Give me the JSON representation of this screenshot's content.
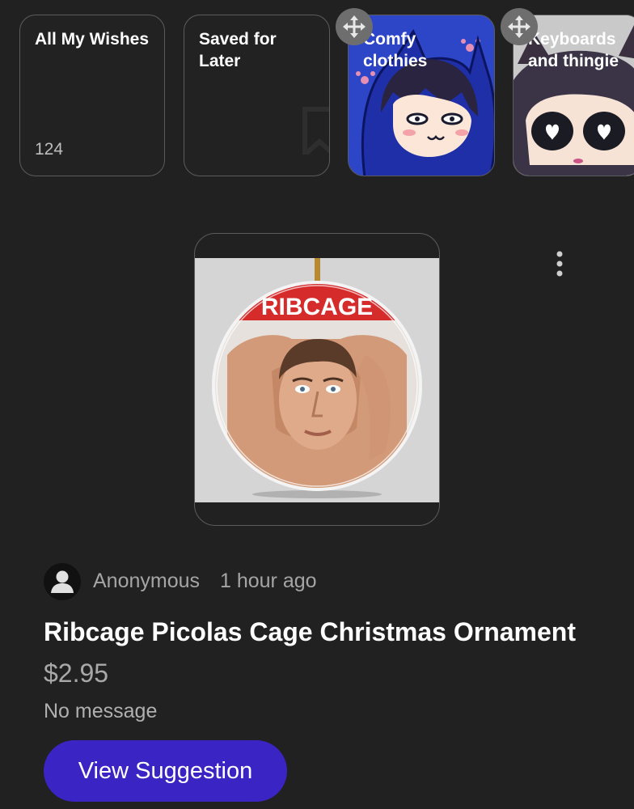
{
  "collections": [
    {
      "title": "All My Wishes",
      "count": "124"
    },
    {
      "title": "Saved for\nLater"
    },
    {
      "title": "Comfy\nclothies"
    },
    {
      "title": "Keyboards\nand thingie"
    }
  ],
  "suggestion": {
    "image_text": "RIBCAGE",
    "author": "Anonymous",
    "time": "1 hour ago",
    "title": "Ribcage Picolas Cage Christmas Ornament",
    "price": "$2.95",
    "message": "No message",
    "button_label": "View Suggestion"
  },
  "colors": {
    "background": "#212121",
    "accent_button": "#3a24c4",
    "ornament_band": "#d62b2b"
  },
  "icons": {
    "move": "move-arrows-icon",
    "more": "more-vertical-icon",
    "avatar": "person-icon",
    "bookmark": "bookmark-icon"
  }
}
